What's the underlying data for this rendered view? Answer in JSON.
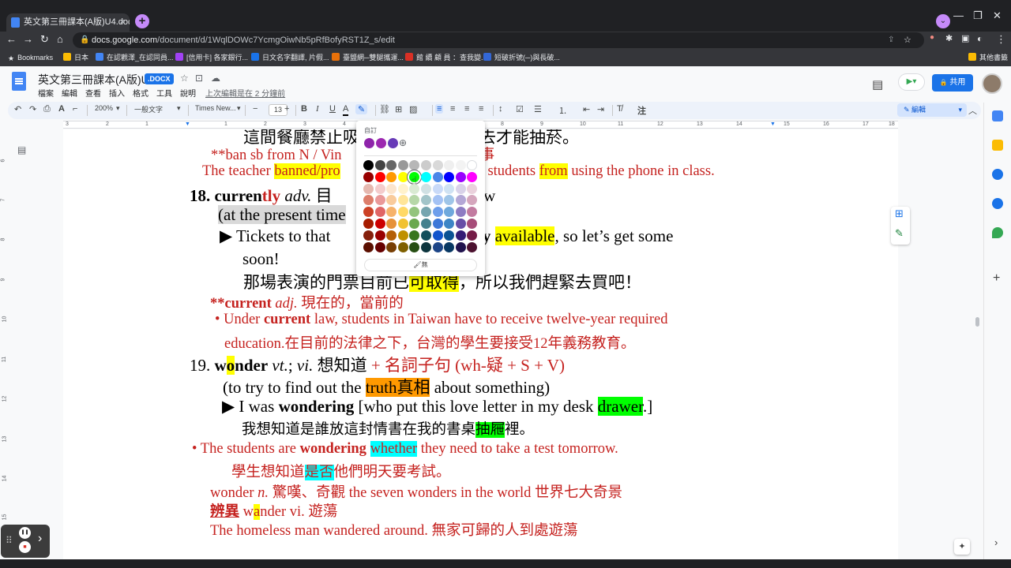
{
  "browser": {
    "tab_title": "英文第三冊課本(A版)U4.docx - G",
    "tab_close": "×",
    "new_tab": "+",
    "tab_menu": "⌄",
    "window_controls": [
      "—",
      "❐",
      "✕"
    ],
    "nav": {
      "back": "←",
      "forward": "→",
      "reload": "↻",
      "home": "⌂"
    },
    "url_host": "docs.google.com",
    "url_path": "/document/d/1WqlDOWc7YcmgOiwNb5pRfBofyRST1Z_s/edit",
    "omni_icons": [
      "⇪",
      "☆",
      "●",
      "✱",
      "▣",
      "◐",
      "⋮"
    ],
    "bookmarks": [
      {
        "label": "Bookmarks",
        "color": "#e8eaed"
      },
      {
        "label": "日本",
        "color": "#fbbc04"
      },
      {
        "label": "在認觀澤_在認同員...",
        "color": "#4285f4"
      },
      {
        "label": "[信用卡] 各家銀行...",
        "color": "#a142f4"
      },
      {
        "label": "日文名字翻譯, 片假...",
        "color": "#1a73e8"
      },
      {
        "label": "臺鹽網─雙腿攜運...",
        "color": "#e8710a"
      },
      {
        "label": "館 續 顧 員 ：查我變...",
        "color": "#d93025"
      },
      {
        "label": "短破折號(─)與長破...",
        "color": "#3367d6"
      },
      {
        "label": "其他書籤",
        "color": "#fbbc04"
      }
    ]
  },
  "docs": {
    "title": "英文第三冊課本(A版)U4",
    "badge": ".DOCX",
    "header_icons": [
      "☆",
      "⊡",
      "☁"
    ],
    "menus": [
      "檔案",
      "編輯",
      "查看",
      "插入",
      "格式",
      "工具",
      "說明"
    ],
    "last_edit": "上次編輯是在 2 分鐘前",
    "share_label": "共用",
    "share_lock": "🔒",
    "comment_icon": "▤",
    "meet_icon": "▶▾",
    "toolbar": {
      "undo": "↶",
      "redo": "↷",
      "print": "⎙",
      "spell": "A",
      "paint": "⌐",
      "zoom": "200%",
      "style": "一般文字",
      "font": "Times New...",
      "minus": "−",
      "size": "13",
      "plus": "+",
      "bold": "B",
      "italic": "I",
      "underline": "U",
      "text_color": "A",
      "highlight": "✎",
      "link": "⛓",
      "comment": "⊞",
      "image": "▨",
      "align_icons": [
        "≡",
        "≡",
        "≡",
        "≡"
      ],
      "spacing": "↕",
      "checklist": "☑",
      "bullets": "☰",
      "numbered": "⒈",
      "indent_less": "⇤",
      "indent_more": "⇥",
      "clear": "T̸",
      "more": "注",
      "edit_mode": "編輯",
      "collapse": "︿"
    },
    "ruler_numbers": [
      "3",
      "2",
      "1",
      "",
      "1",
      "2",
      "3",
      "4",
      "5",
      "6",
      "7",
      "8",
      "9",
      "10",
      "11",
      "12",
      "13",
      "14",
      "15",
      "16",
      "17",
      "18"
    ],
    "left_ruler_numbers": [
      "6",
      "7",
      "8",
      "9",
      "10",
      "11",
      "12",
      "13",
      "14",
      "15"
    ],
    "side_icons": [
      {
        "name": "calendar",
        "color": "#4285f4"
      },
      {
        "name": "keep",
        "color": "#fbbc04"
      },
      {
        "name": "tasks",
        "color": "#1a73e8"
      },
      {
        "name": "contacts",
        "color": "#1a73e8"
      },
      {
        "name": "maps",
        "color": "#34a853"
      }
    ],
    "side_plus": "+",
    "side_expand": "›",
    "float_add_comment": "⊞",
    "float_suggest": "✎",
    "explore": "✦"
  },
  "palette": {
    "label": "自訂",
    "custom_colors": [
      "#8e24aa",
      "#9c27b0",
      "#673ab7"
    ],
    "add_custom": "⊕",
    "none_label": "無",
    "none_icon": "🖌",
    "grid": [
      [
        "#000000",
        "#434343",
        "#666666",
        "#999999",
        "#b7b7b7",
        "#cccccc",
        "#d9d9d9",
        "#efefef",
        "#f3f3f3",
        "#ffffff"
      ],
      [
        "#980000",
        "#ff0000",
        "#ff9900",
        "#ffff00",
        "#00ff00",
        "#00ffff",
        "#4a86e8",
        "#0000ff",
        "#9900ff",
        "#ff00ff"
      ],
      [
        "#e6b8af",
        "#f4cccc",
        "#fce5cd",
        "#fff2cc",
        "#d9ead3",
        "#d0e0e3",
        "#c9daf8",
        "#cfe2f3",
        "#d9d2e9",
        "#ead1dc"
      ],
      [
        "#dd7e6b",
        "#ea9999",
        "#f9cb9c",
        "#ffe599",
        "#b6d7a8",
        "#a2c4c9",
        "#a4c2f4",
        "#9fc5e8",
        "#b4a7d6",
        "#d5a6bd"
      ],
      [
        "#cc4125",
        "#e06666",
        "#f6b26b",
        "#ffd966",
        "#93c47d",
        "#76a5af",
        "#6d9eeb",
        "#6fa8dc",
        "#8e7cc3",
        "#c27ba0"
      ],
      [
        "#a61c00",
        "#cc0000",
        "#e69138",
        "#f1c232",
        "#6aa84f",
        "#45818e",
        "#3c78d8",
        "#3d85c6",
        "#674ea7",
        "#a64d79"
      ],
      [
        "#85200c",
        "#990000",
        "#b45f06",
        "#bf9000",
        "#38761d",
        "#134f5c",
        "#1155cc",
        "#0b5394",
        "#351c75",
        "#741b47"
      ],
      [
        "#5b0f00",
        "#660000",
        "#783f04",
        "#7f6000",
        "#274e13",
        "#0c343d",
        "#1c4587",
        "#073763",
        "#20124d",
        "#4c1130"
      ]
    ]
  },
  "content": {
    "l1": "這間餐廳禁止吸",
    "l1b": "須出去才能抽菸。",
    "l2a": "**ban sb from N / Vin",
    "l2b": "事",
    "l3a": "The teacher ",
    "l3b": "banned/pro",
    "l3c": "r students ",
    "l3d": "from",
    "l3e": " using the phone in class.",
    "l4a": "18. curren",
    "l4b": "tly",
    "l4c": " adv.",
    "l4d": " 目",
    "l4e": "ow",
    "l5": "(at the present time",
    "l6a": "▶ Tickets to that",
    "l6b": "ntly ",
    "l6c": "available",
    "l6d": ", so let’s get some",
    "l7": "soon!",
    "l8a": "那場表演的門票目前已",
    "l8b": "可取得",
    "l8c": "，所以我們趕緊去買吧！",
    "l9a": "**current",
    "l9b": " adj.",
    "l9c": " 現在的，當前的",
    "l10a": "• Under ",
    "l10b": "current",
    "l10c": " law, students in Taiwan have to receive twelve-year required",
    "l11": "education.在目前的法律之下，台灣的學生要接受12年義務教育。",
    "l12a": "19. ",
    "l12b": "w",
    "l12c": "o",
    "l12d": "nder",
    "l12e": " vt.",
    "l12f": "; ",
    "l12g": "vi.",
    "l12h": " 想知道",
    "l12i": " + 名詞子句 (wh-疑 + S + V)",
    "l13a": "(to try to find out the ",
    "l13b": "truth真相",
    "l13c": " about something)",
    "l14a": "▶ I was ",
    "l14b": "wondering",
    "l14c": " [who put this love letter in my desk ",
    "l14d": "drawer",
    "l14e": ".]",
    "l15a": "我想知道是誰放這封情書在我的書桌",
    "l15b": "抽屜",
    "l15c": "裡。",
    "l16a": "• The students are ",
    "l16b": "wondering",
    "l16c": " ",
    "l16d": "whether",
    "l16e": " they need to take a test tomorrow.",
    "l17a": "學生想知道",
    "l17b": "是否",
    "l17c": "他們明天要考試。",
    "l18a": "wonder ",
    "l18b": "n.",
    "l18c": " 驚嘆、奇觀 the seven wonders in the world 世界七大奇景",
    "l19a": "辨異",
    "l19b": "  w",
    "l19c": "a",
    "l19d": "nder vi. 遊蕩",
    "l20": "The homeless man wandered around. 無家可歸的人到處遊蕩"
  },
  "recorder": {
    "pause": "❚❚",
    "stop": "■",
    "grip": "⠿",
    "expand": "›"
  }
}
